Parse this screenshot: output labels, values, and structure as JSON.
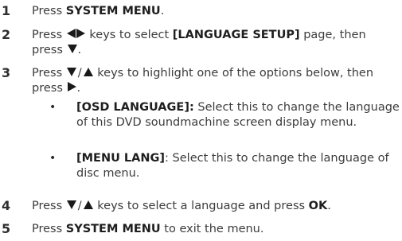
{
  "steps": [
    {
      "number": "1",
      "press": "Press",
      "key": "SYSTEM MENU",
      "end": "."
    },
    {
      "number": "2",
      "press": "Press",
      "mid": "keys to select",
      "key": "[LANGUAGE SETUP]",
      "then": "page, then press",
      "end": "."
    },
    {
      "number": "3",
      "press": "Press",
      "mid": "keys to highlight one of the options below, then press",
      "end": ".",
      "options": [
        {
          "bullet": "•",
          "key": "[OSD LANGUAGE]:",
          "text": "Select this to change the language of this DVD soundmachine screen display menu."
        },
        {
          "bullet": "•",
          "key": "[MENU LANG]",
          "text": ": Select this to change the language of disc menu."
        }
      ]
    },
    {
      "number": "4",
      "press": "Press",
      "mid": "keys to select a language and press",
      "key": "OK",
      "end": "."
    },
    {
      "number": "5",
      "press": "Press",
      "key": "SYSTEM MENU",
      "end": "to exit the menu."
    }
  ],
  "icons": {
    "left": "left-triangle-icon",
    "right": "right-triangle-icon",
    "down": "down-triangle-icon",
    "up": "up-triangle-icon"
  }
}
